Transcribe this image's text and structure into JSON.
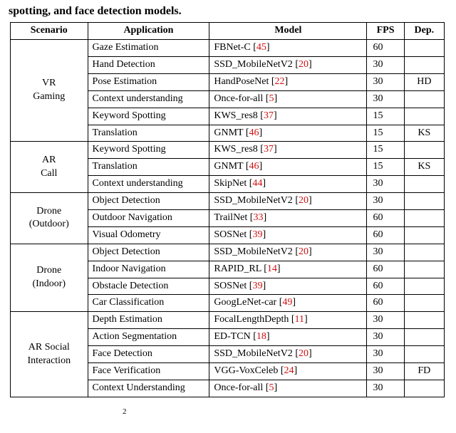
{
  "caption_fragment": "spotting, and face detection models.",
  "headers": {
    "scenario": "Scenario",
    "application": "Application",
    "model": "Model",
    "fps": "FPS",
    "dep": "Dep."
  },
  "groups": [
    {
      "scenario_lines": [
        "VR",
        "Gaming"
      ],
      "rows": [
        {
          "application": "Gaze Estimation",
          "model_name": "FBNet-C",
          "model_ref": "45",
          "fps": "60",
          "dep": ""
        },
        {
          "application": "Hand Detection",
          "model_name": "SSD_MobileNetV2",
          "model_ref": "20",
          "fps": "30",
          "dep": ""
        },
        {
          "application": "Pose Estimation",
          "model_name": "HandPoseNet",
          "model_ref": "22",
          "fps": "30",
          "dep": "HD"
        },
        {
          "application": "Context understanding",
          "model_name": "Once-for-all",
          "model_ref": "5",
          "fps": "30",
          "dep": ""
        },
        {
          "application": "Keyword Spotting",
          "model_name": "KWS_res8",
          "model_ref": "37",
          "fps": "15",
          "dep": ""
        },
        {
          "application": "Translation",
          "model_name": "GNMT",
          "model_ref": "46",
          "fps": "15",
          "dep": "KS"
        }
      ]
    },
    {
      "scenario_lines": [
        "AR",
        "Call"
      ],
      "rows": [
        {
          "application": "Keyword Spotting",
          "model_name": "KWS_res8",
          "model_ref": "37",
          "fps": "15",
          "dep": ""
        },
        {
          "application": "Translation",
          "model_name": "GNMT",
          "model_ref": "46",
          "fps": "15",
          "dep": "KS"
        },
        {
          "application": "Context understanding",
          "model_name": "SkipNet",
          "model_ref": "44",
          "fps": "30",
          "dep": ""
        }
      ]
    },
    {
      "scenario_lines": [
        "Drone",
        "(Outdoor)"
      ],
      "rows": [
        {
          "application": "Object Detection",
          "model_name": "SSD_MobileNetV2",
          "model_ref": "20",
          "fps": "30",
          "dep": ""
        },
        {
          "application": "Outdoor Navigation",
          "model_name": "TrailNet",
          "model_ref": "33",
          "fps": "60",
          "dep": ""
        },
        {
          "application": "Visual Odometry",
          "model_name": "SOSNet",
          "model_ref": "39",
          "fps": "60",
          "dep": ""
        }
      ]
    },
    {
      "scenario_lines": [
        "Drone",
        "(Indoor)"
      ],
      "rows": [
        {
          "application": "Object Detection",
          "model_name": "SSD_MobileNetV2",
          "model_ref": "20",
          "fps": "30",
          "dep": ""
        },
        {
          "application": "Indoor Navigation",
          "model_name": "RAPID_RL",
          "model_ref": "14",
          "fps": "60",
          "dep": ""
        },
        {
          "application": "Obstacle Detection",
          "model_name": "SOSNet",
          "model_ref": "39",
          "fps": "60",
          "dep": ""
        },
        {
          "application": "Car Classification",
          "model_name": "GoogLeNet-car",
          "model_ref": "49",
          "fps": "60",
          "dep": ""
        }
      ]
    },
    {
      "scenario_lines": [
        "AR Social",
        "Interaction"
      ],
      "rows": [
        {
          "application": "Depth Estimation",
          "model_name": "FocalLengthDepth",
          "model_ref": "11",
          "fps": "30",
          "dep": ""
        },
        {
          "application": "Action Segmentation",
          "model_name": "ED-TCN",
          "model_ref": "18",
          "fps": "30",
          "dep": ""
        },
        {
          "application": "Face Detection",
          "model_name": "SSD_MobileNetV2",
          "model_ref": "20",
          "fps": "30",
          "dep": ""
        },
        {
          "application": "Face Verification",
          "model_name": "VGG-VoxCeleb",
          "model_ref": "24",
          "fps": "30",
          "dep": "FD"
        },
        {
          "application": "Context Understanding",
          "model_name": "Once-for-all",
          "model_ref": "5",
          "fps": "30",
          "dep": ""
        }
      ]
    }
  ],
  "footnote_marker": "2"
}
